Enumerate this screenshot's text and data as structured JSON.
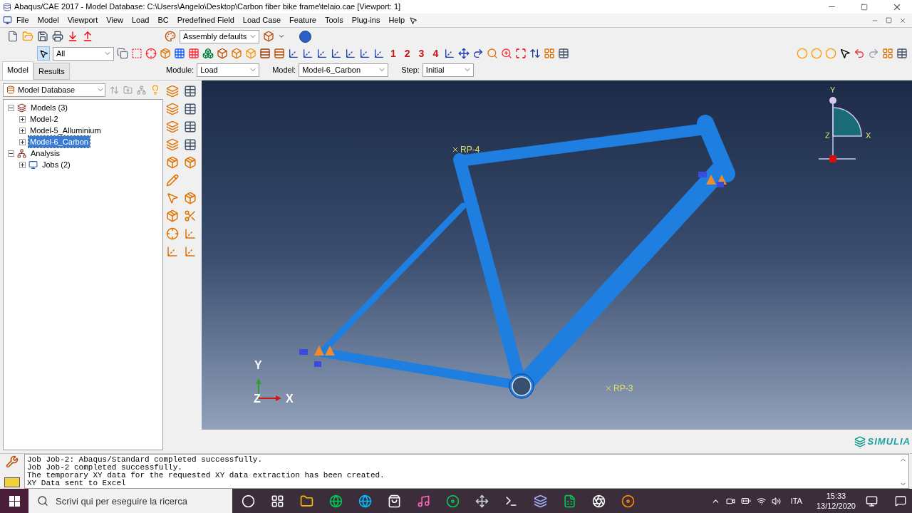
{
  "window": {
    "title": "Abaqus/CAE 2017 - Model Database: C:\\Users\\Angelo\\Desktop\\Carbon fiber bike frame\\telaio.cae [Viewport: 1]"
  },
  "menu": [
    "File",
    "Model",
    "Viewport",
    "View",
    "Load",
    "BC",
    "Predefined Field",
    "Load Case",
    "Feature",
    "Tools",
    "Plug-ins",
    "Help"
  ],
  "toolbar": {
    "render_style": "Assembly defaults",
    "selection_filter": "All",
    "views": [
      "1",
      "2",
      "3",
      "4"
    ]
  },
  "tabs": [
    {
      "label": "Model",
      "selected": true
    },
    {
      "label": "Results",
      "selected": false
    }
  ],
  "context": [
    {
      "label": "Module:",
      "value": "Load"
    },
    {
      "label": "Model:",
      "value": "Model-6_Carbon"
    },
    {
      "label": "Step:",
      "value": "Initial"
    }
  ],
  "tree_source": "Model Database",
  "tree": [
    {
      "label": "Models (3)",
      "expanded": true,
      "selected": false,
      "children": [
        {
          "label": "Model-2",
          "expanded": false,
          "selected": false
        },
        {
          "label": "Model-5_Alluminium",
          "expanded": false,
          "selected": false
        },
        {
          "label": "Model-6_Carbon",
          "expanded": false,
          "selected": true
        }
      ]
    },
    {
      "label": "Analysis",
      "expanded": true,
      "selected": false,
      "children": [
        {
          "label": "Jobs (2)",
          "expanded": false,
          "selected": false
        }
      ]
    }
  ],
  "viewport": {
    "points": [
      {
        "label": "RP-4"
      },
      {
        "label": "RP-3"
      }
    ],
    "triad": [
      "Y",
      "Z",
      "X"
    ],
    "view_triad": [
      "Y",
      "Z",
      "X"
    ],
    "logo": "SIMULIA"
  },
  "messages": [
    "Job Job-2: Abaqus/Standard completed successfully.",
    "Job Job-2 completed successfully.",
    "The temporary XY data for the requested XY data extraction has been created.",
    "XY Data sent to Excel"
  ],
  "taskbar": {
    "search_placeholder": "Scrivi qui per eseguire la ricerca",
    "language": "ITA",
    "time": "15:33",
    "date": "13/12/2020"
  }
}
